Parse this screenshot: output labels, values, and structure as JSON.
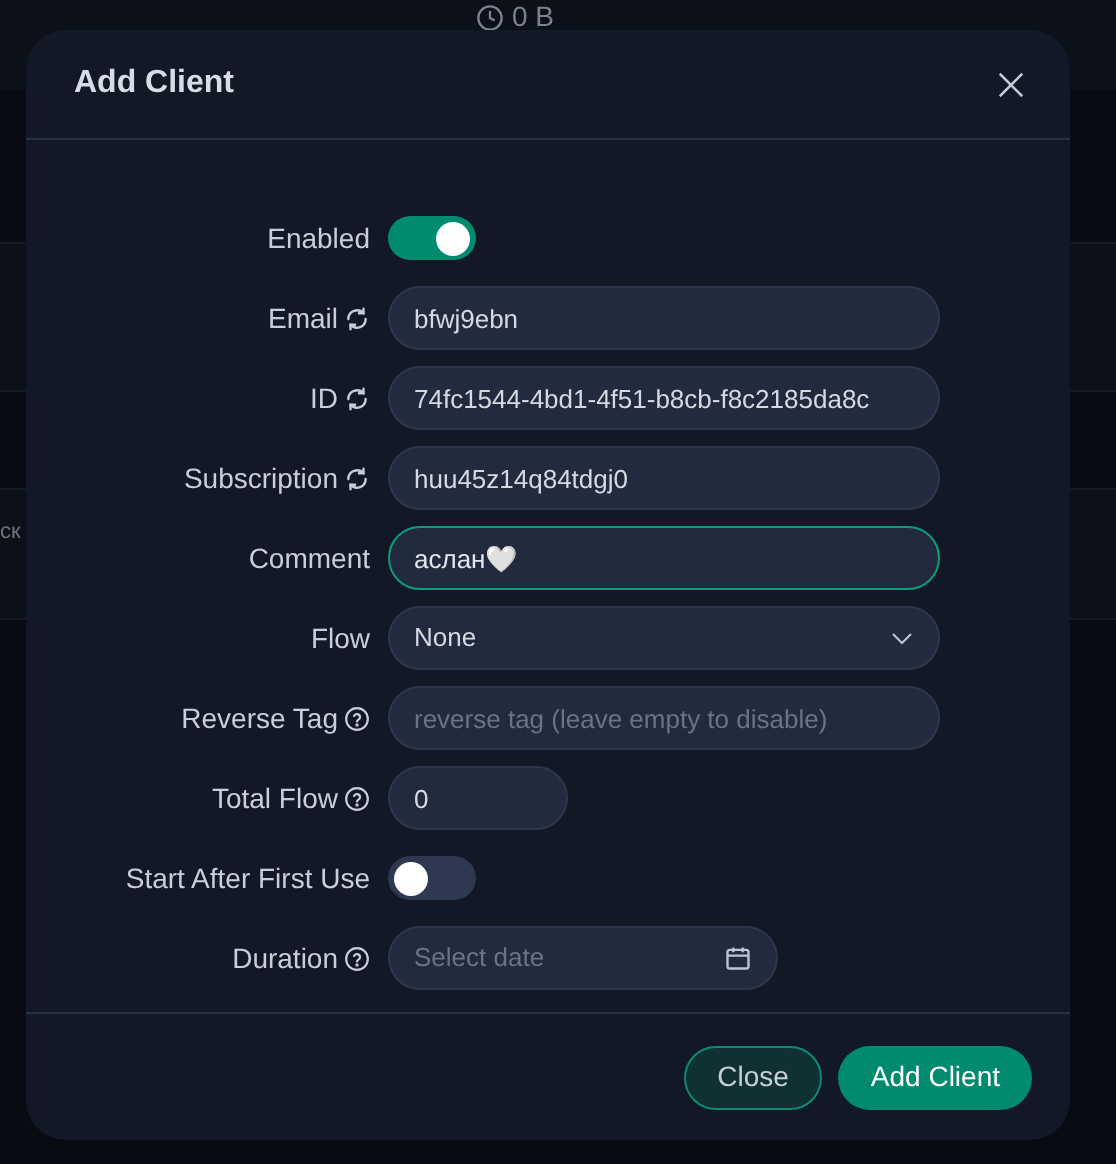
{
  "background": {
    "traffic": "0 B",
    "cell_fragment": "ск"
  },
  "dialog": {
    "title": "Add Client",
    "fields": [
      {
        "kind": "switch",
        "label": "Enabled",
        "on": true
      },
      {
        "kind": "text",
        "label": "Email",
        "refresh": true,
        "value": "bfwj9ebn",
        "focused": false
      },
      {
        "kind": "text",
        "label": "ID",
        "refresh": true,
        "value": "74fc1544-4bd1-4f51-b8cb-f8c2185da8c",
        "focused": false
      },
      {
        "kind": "text",
        "label": "Subscription",
        "refresh": true,
        "value": "huu45z14q84tdgj0",
        "focused": false
      },
      {
        "kind": "text",
        "label": "Comment",
        "value": "аслан🤍",
        "focused": true
      },
      {
        "kind": "select",
        "label": "Flow",
        "value": "None"
      },
      {
        "kind": "text",
        "label": "Reverse Tag",
        "help": true,
        "placeholder": "reverse tag (leave empty to disable)",
        "focused": false
      },
      {
        "kind": "number",
        "label": "Total Flow",
        "help": true,
        "value": "0"
      },
      {
        "kind": "switch",
        "label": "Start After First Use",
        "on": false
      },
      {
        "kind": "date",
        "label": "Duration",
        "help": true,
        "placeholder": "Select date"
      }
    ],
    "buttons": [
      {
        "label": "Close",
        "kind": "secondary"
      },
      {
        "label": "Add Client",
        "kind": "primary"
      }
    ]
  }
}
